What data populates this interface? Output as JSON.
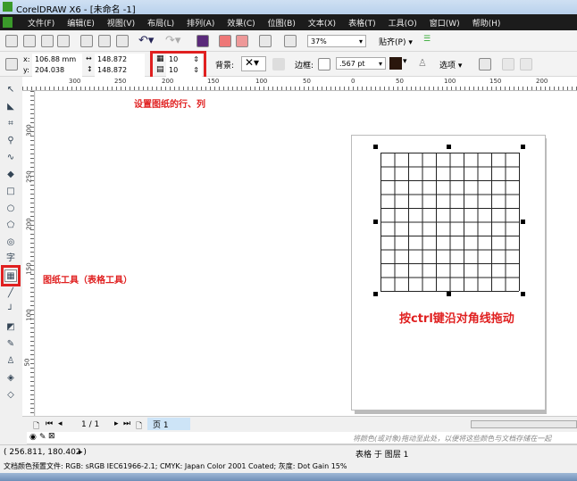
{
  "window": {
    "title": "CorelDRAW X6 - [未命名 -1]"
  },
  "menu": [
    "文件(F)",
    "编辑(E)",
    "视图(V)",
    "布局(L)",
    "排列(A)",
    "效果(C)",
    "位图(B)",
    "文本(X)",
    "表格(T)",
    "工具(O)",
    "窗口(W)",
    "帮助(H)"
  ],
  "toolbar": {
    "zoom": "37%",
    "snap": "贴齐(P)"
  },
  "props": {
    "x": "106.88 mm",
    "y": "204.038 mm",
    "width": "148.872 mm",
    "height": "148.872 mm",
    "rows": "10",
    "cols": "10",
    "background_label": "背景:",
    "border_label": "边框:",
    "border_width": ".567 pt",
    "options": "选项",
    "outline_color": "#2a160c"
  },
  "ruler": {
    "top": [
      "300",
      "250",
      "200",
      "150",
      "100",
      "50",
      "0",
      "50",
      "100",
      "150",
      "200"
    ],
    "left": [
      "300",
      "250",
      "200",
      "150",
      "100",
      "50"
    ]
  },
  "annotations": {
    "rows_cols": "设置图纸的行、列",
    "tool": "图纸工具（表格工具）",
    "drag": "按ctrl键沿对角线拖动"
  },
  "grid": {
    "rows": 10,
    "cols": 10
  },
  "pagenav": {
    "pages": "1 / 1",
    "tab": "页 1"
  },
  "hint": "将颜色(或对象)拖动至此处，以便将这些颜色与文档存储在一起",
  "status": {
    "coords": "( 256.811, 180.402 )",
    "selection": "表格 于 图层 1",
    "color_profile": "文档颜色预置文件: RGB: sRGB IEC61966-2.1; CMYK: Japan Color 2001 Coated; 灰度: Dot Gain 15%"
  },
  "colors": {
    "annotation": "#e02020",
    "highlight": "#e02020"
  }
}
